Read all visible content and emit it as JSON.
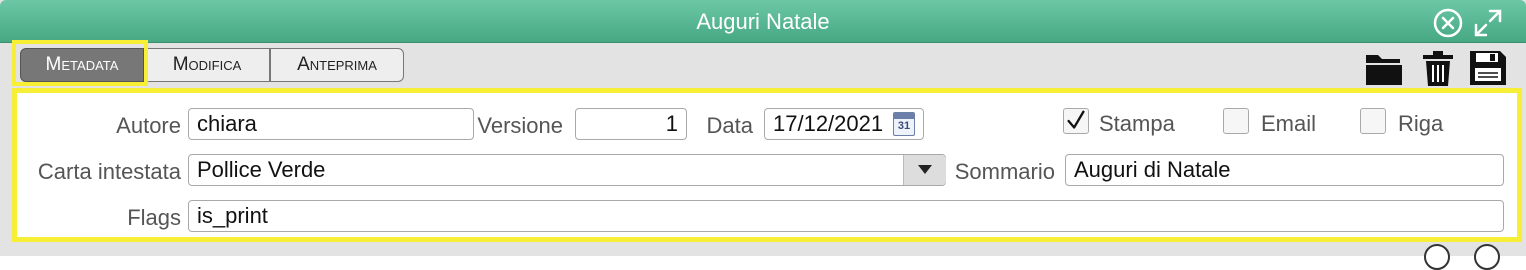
{
  "window": {
    "title": "Auguri Natale"
  },
  "tabs": [
    {
      "label": "Metadata",
      "active": true
    },
    {
      "label": "Modifica",
      "active": false
    },
    {
      "label": "Anteprima",
      "active": false
    }
  ],
  "actions": [
    "folder-icon",
    "trash-icon",
    "save-icon"
  ],
  "form": {
    "autore": {
      "label": "Autore",
      "value": "chiara"
    },
    "versione": {
      "label": "Versione",
      "value": "1"
    },
    "data": {
      "label": "Data",
      "value": "17/12/2021",
      "calendar_day": "31"
    },
    "stampa": {
      "label": "Stampa",
      "checked": true
    },
    "email": {
      "label": "Email",
      "checked": false
    },
    "riga": {
      "label": "Riga",
      "checked": false
    },
    "carta_intestata": {
      "label": "Carta intestata",
      "value": "Pollice Verde"
    },
    "sommario": {
      "label": "Sommario",
      "value": "Auguri di Natale"
    },
    "flags": {
      "label": "Flags",
      "value": "is_print"
    }
  },
  "colors": {
    "titlebar": "#56b892",
    "highlight": "#f7ef36",
    "active_tab": "#777777"
  }
}
